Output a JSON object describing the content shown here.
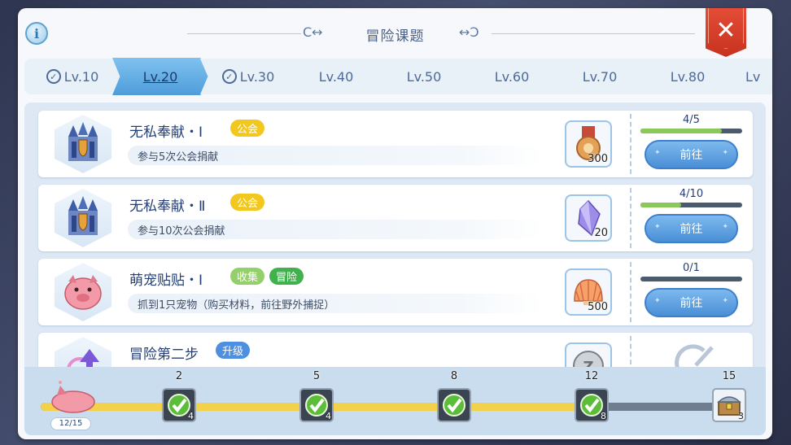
{
  "window": {
    "title": "冒险课题",
    "info_icon": "info-icon",
    "close_icon": "close-icon"
  },
  "tabs": [
    {
      "label": "Lv.10",
      "completed": true
    },
    {
      "label": "Lv.20",
      "completed": false,
      "active": true
    },
    {
      "label": "Lv.30",
      "completed": true
    },
    {
      "label": "Lv.40",
      "completed": false
    },
    {
      "label": "Lv.50",
      "completed": false
    },
    {
      "label": "Lv.60",
      "completed": false
    },
    {
      "label": "Lv.70",
      "completed": false
    },
    {
      "label": "Lv.80",
      "completed": false
    },
    {
      "label": "Lv",
      "completed": false
    }
  ],
  "quests": [
    {
      "name": "无私奉献・Ⅰ",
      "tags": [
        {
          "label": "公会",
          "color": "#f2c81f"
        }
      ],
      "description": "参与5次公会捐献",
      "icon": "guild-castle-icon",
      "reward_icon": "medal-icon",
      "reward_count": "300",
      "progress_text": "4/5",
      "progress": 0.8,
      "button": "前往"
    },
    {
      "name": "无私奉献・Ⅱ",
      "tags": [
        {
          "label": "公会",
          "color": "#f2c81f"
        }
      ],
      "description": "参与10次公会捐献",
      "icon": "guild-castle-icon",
      "reward_icon": "crystal-icon",
      "reward_count": "20",
      "progress_text": "4/10",
      "progress": 0.4,
      "button": "前往"
    },
    {
      "name": "萌宠贴贴・Ⅰ",
      "tags": [
        {
          "label": "收集",
          "color": "#93d06a"
        },
        {
          "label": "冒险",
          "color": "#3fb24c"
        }
      ],
      "description": "抓到1只宠物（购买材料，前往野外捕捉）",
      "icon": "pink-pet-icon",
      "reward_icon": "shell-icon",
      "reward_count": "500",
      "progress_text": "0/1",
      "progress": 0,
      "button": "前往"
    },
    {
      "name": "冒险第二步",
      "tags": [
        {
          "label": "升级",
          "color": "#4f8fe0"
        }
      ],
      "icon": "level-up-icon",
      "reward_icon": "zeny-coin-icon"
    }
  ],
  "overall_progress": {
    "label": "12/15",
    "value": 12,
    "max": 15,
    "milestones": [
      {
        "threshold": "2",
        "count": "4",
        "claimed": true
      },
      {
        "threshold": "5",
        "count": "4",
        "claimed": true
      },
      {
        "threshold": "8",
        "count": "",
        "claimed": true
      },
      {
        "threshold": "12",
        "count": "8",
        "claimed": true
      },
      {
        "threshold": "15",
        "count": "3",
        "claimed": false,
        "icon": "treasure-chest-icon"
      }
    ]
  }
}
